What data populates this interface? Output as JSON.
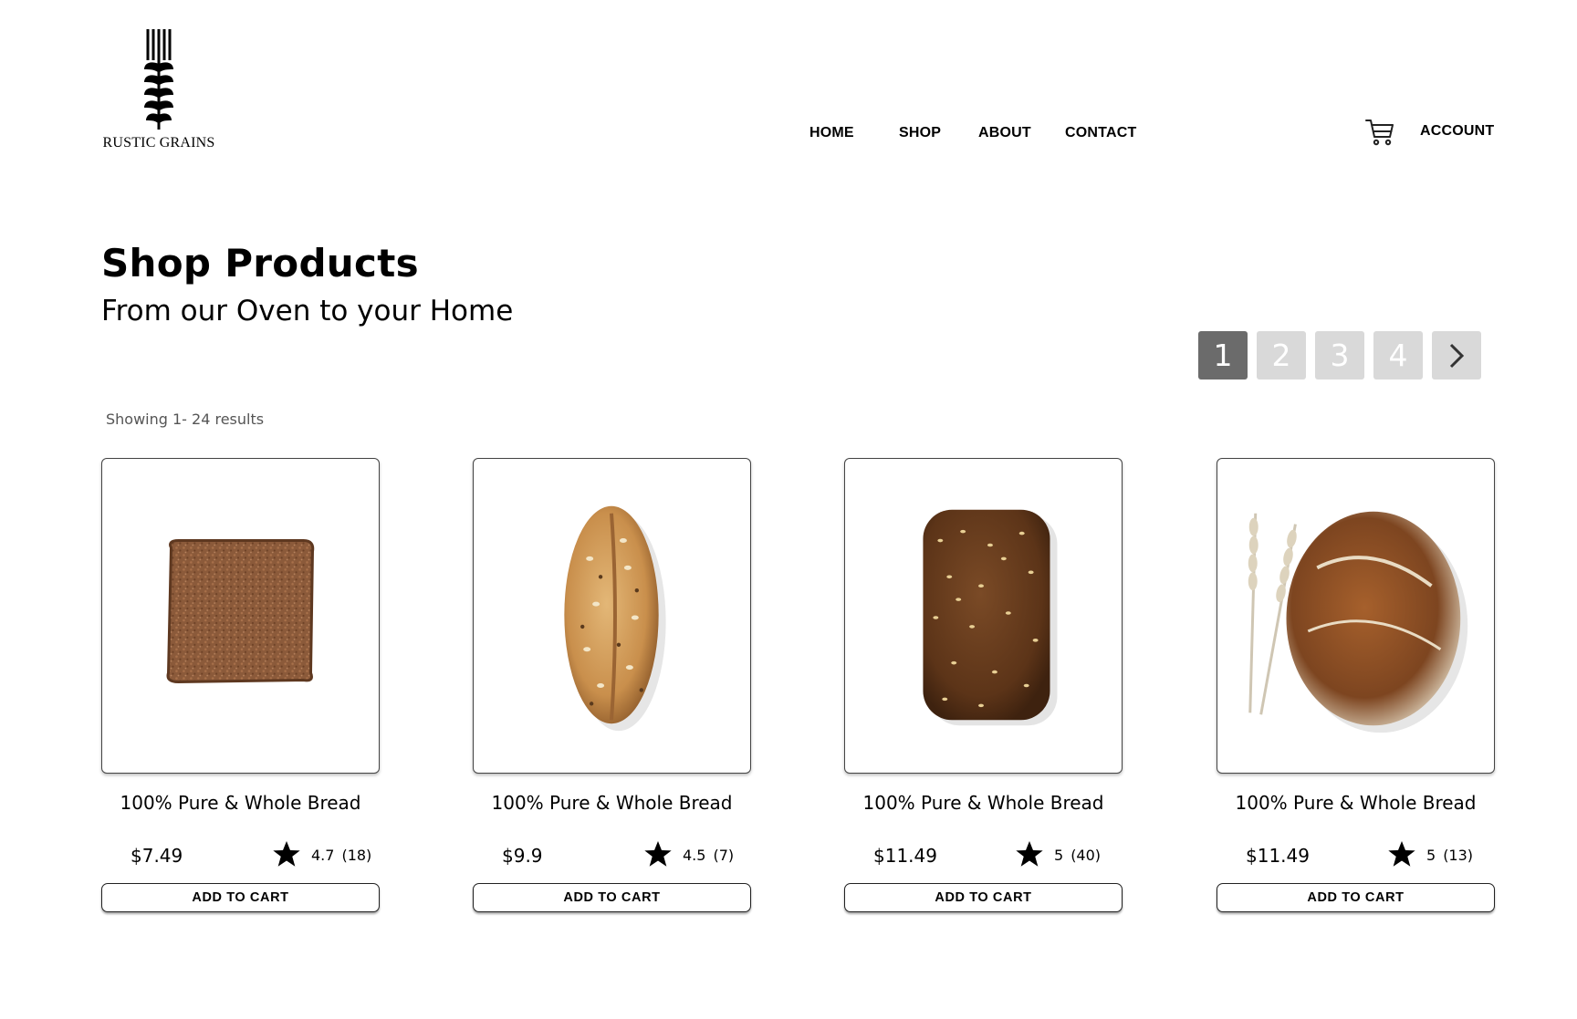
{
  "brand": {
    "name": "RUSTIC GRAINS",
    "logo_icon": "wheat-icon"
  },
  "nav": {
    "items": [
      "HOME",
      "SHOP",
      "ABOUT",
      "CONTACT"
    ]
  },
  "header": {
    "cart_icon": "shopping-cart-icon",
    "account_label": "ACCOUNT"
  },
  "page": {
    "title": "Shop Products",
    "subtitle": "From our Oven to your Home"
  },
  "pagination": {
    "pages": [
      "1",
      "2",
      "3",
      "4"
    ],
    "current": "1",
    "next_icon": "chevron-right-icon"
  },
  "results_text": "Showing 1- 24 results",
  "colors": {
    "active_page": "#6b6b6b",
    "inactive_page": "#d9d9d9"
  },
  "products": [
    {
      "name": "100% Pure & Whole Bread",
      "price": "$7.49",
      "rating": "4.7",
      "reviews": "(18)",
      "button": "ADD TO CART",
      "image": "rye-bread-slice"
    },
    {
      "name": "100% Pure & Whole Bread",
      "price": "$9.9",
      "rating": "4.5",
      "reviews": "(7)",
      "button": "ADD TO CART",
      "image": "seeded-oval-loaf"
    },
    {
      "name": "100% Pure & Whole Bread",
      "price": "$11.49",
      "rating": "5",
      "reviews": "(40)",
      "button": "ADD TO CART",
      "image": "sesame-whole-grain-loaf"
    },
    {
      "name": "100% Pure & Whole Bread",
      "price": "$11.49",
      "rating": "5",
      "reviews": "(13)",
      "button": "ADD TO CART",
      "image": "sourdough-boule-with-wheat"
    }
  ]
}
